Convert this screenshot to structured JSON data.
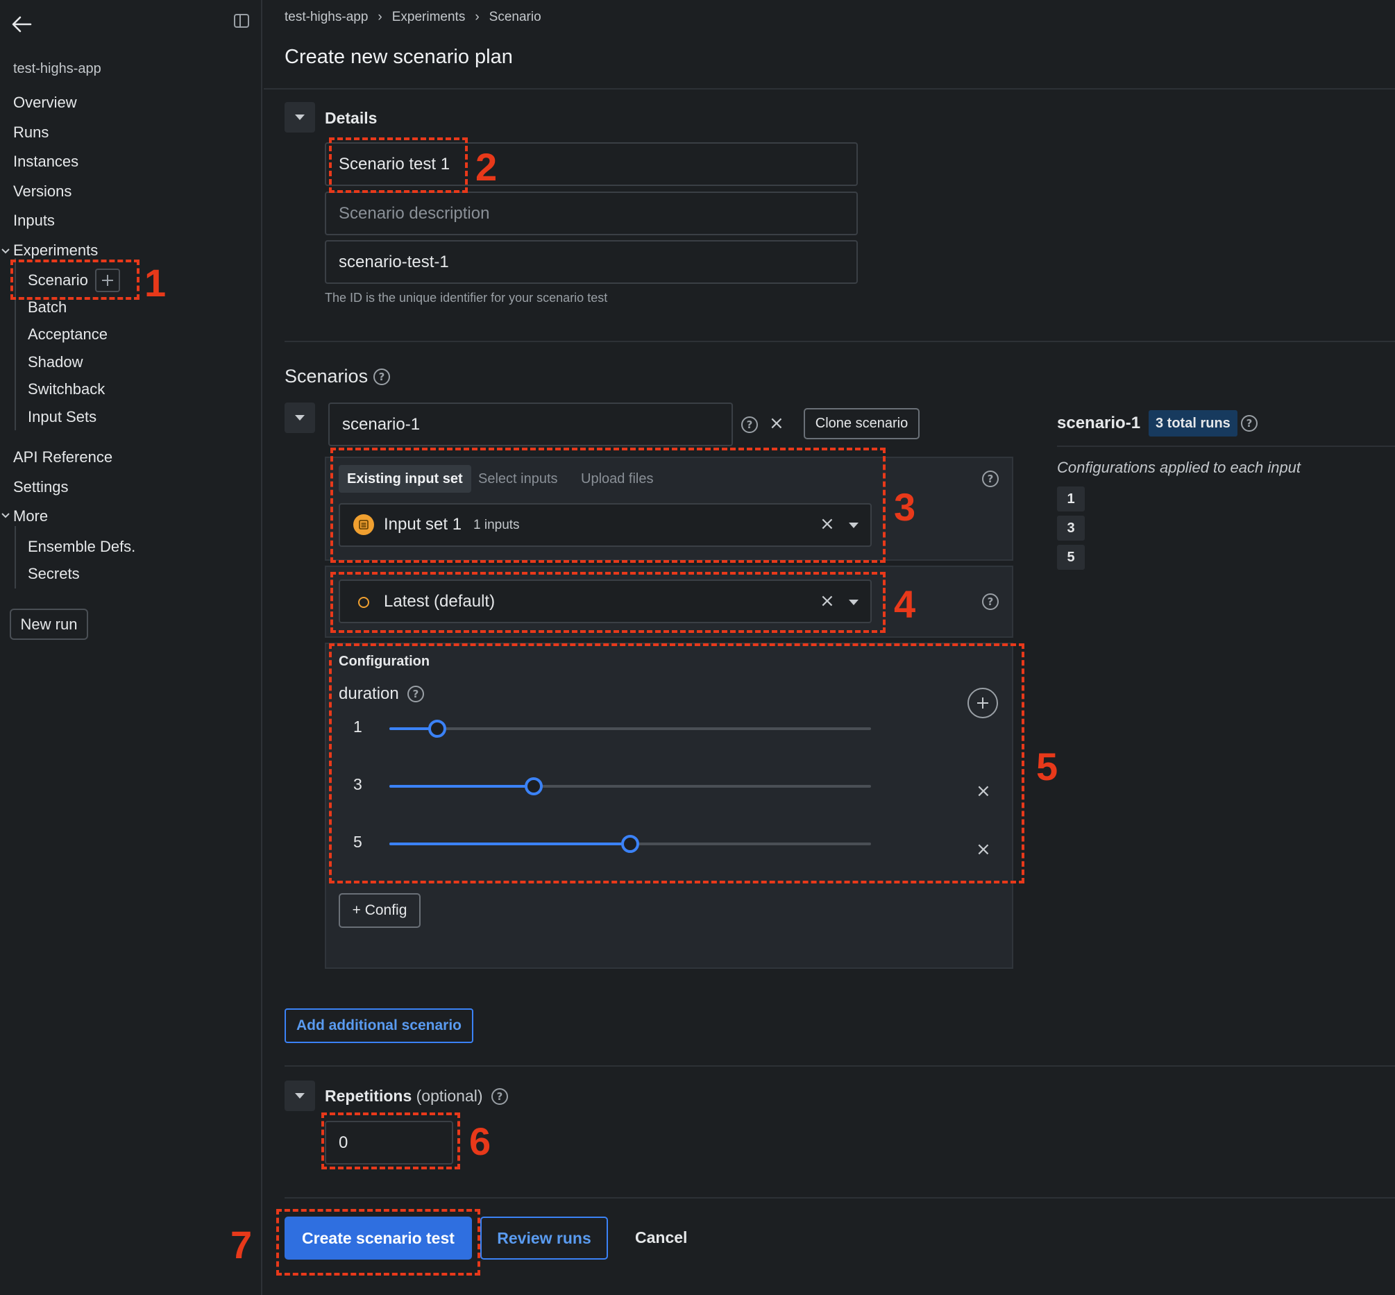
{
  "sidebar": {
    "app_name": "test-highs-app",
    "items": {
      "overview": "Overview",
      "runs": "Runs",
      "instances": "Instances",
      "versions": "Versions",
      "inputs": "Inputs",
      "experiments": "Experiments",
      "scenario": "Scenario",
      "batch": "Batch",
      "acceptance": "Acceptance",
      "shadow": "Shadow",
      "switchback": "Switchback",
      "input_sets": "Input Sets",
      "api_reference": "API Reference",
      "settings": "Settings",
      "more": "More",
      "ensemble_defs": "Ensemble Defs.",
      "secrets": "Secrets"
    },
    "new_run_label": "New run"
  },
  "breadcrumb": {
    "app": "test-highs-app",
    "experiments": "Experiments",
    "scenario": "Scenario"
  },
  "page_title": "Create new scenario plan",
  "details": {
    "heading": "Details",
    "name_value": "Scenario test 1",
    "description_placeholder": "Scenario description",
    "id_value": "scenario-test-1",
    "id_helper": "The ID is the unique identifier for your scenario test"
  },
  "scenarios": {
    "heading": "Scenarios",
    "scenario_name": "scenario-1",
    "clone_label": "Clone scenario",
    "tabs": {
      "existing": "Existing input set",
      "select": "Select inputs",
      "upload": "Upload files"
    },
    "input_set_name": "Input set 1",
    "input_set_count": "1 inputs",
    "version_label": "Latest (default)",
    "configuration": {
      "heading": "Configuration",
      "param_name": "duration",
      "values": [
        {
          "label": "1",
          "level": 0.1
        },
        {
          "label": "3",
          "level": 0.3
        },
        {
          "label": "5",
          "level": 0.5
        }
      ]
    },
    "add_config_label": "+ Config",
    "add_scenario_label": "Add additional scenario"
  },
  "summary": {
    "scenario_name": "scenario-1",
    "total_runs": "3 total runs",
    "subtitle": "Configurations applied to each input",
    "config_values": [
      "1",
      "3",
      "5"
    ]
  },
  "repetitions": {
    "heading": "Repetitions",
    "optional": "(optional)",
    "value": "0"
  },
  "actions": {
    "create": "Create scenario test",
    "review": "Review runs",
    "cancel": "Cancel"
  },
  "annotations": [
    "1",
    "2",
    "3",
    "4",
    "5",
    "6",
    "7"
  ],
  "colors": {
    "background": "#1c1f22",
    "panel": "#24282d",
    "accent_blue": "#2f6fe0",
    "slider_blue": "#3b82f6",
    "annotation_red": "#e8391a",
    "input_set_orange": "#f0a030",
    "badge_bg": "#173a5e"
  }
}
